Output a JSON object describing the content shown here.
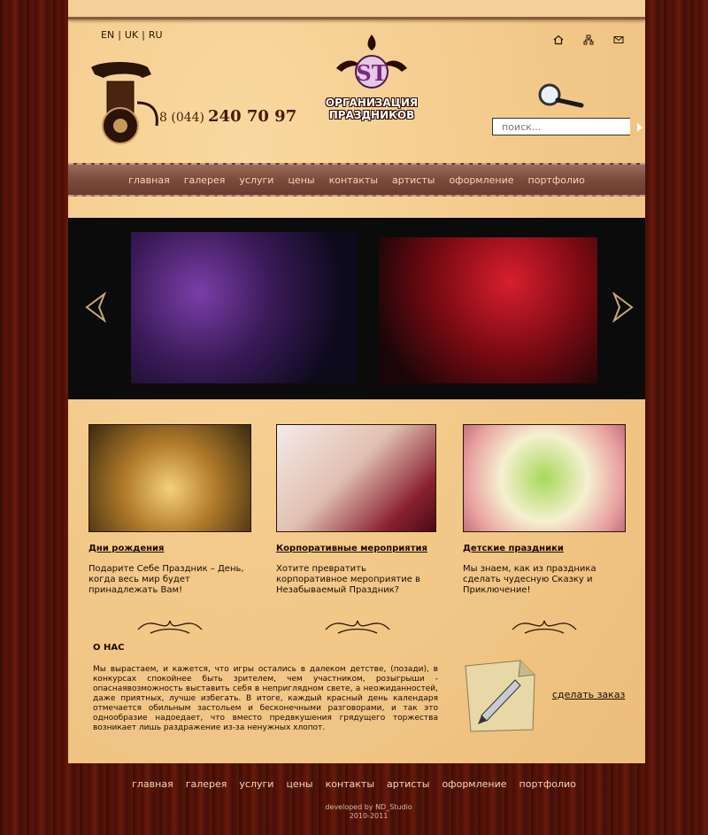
{
  "languages": [
    "EN",
    "UK",
    "RU"
  ],
  "top_icons": [
    "home-icon",
    "sitemap-icon",
    "mail-icon"
  ],
  "phone": {
    "prefix": "8 (044)",
    "number": "240 70 97"
  },
  "logo": {
    "monogram": "ST",
    "line1": "ОРГАНИЗАЦИЯ",
    "line2": "ПРАЗДНИКОВ"
  },
  "search": {
    "placeholder": "поиск..."
  },
  "nav": [
    "главная",
    "галерея",
    "услуги",
    "цены",
    "контакты",
    "артисты",
    "оформление",
    "портфолио"
  ],
  "slider": {
    "prev_icon": "chevron-left-icon",
    "next_icon": "chevron-right-icon"
  },
  "cards": [
    {
      "title": "Дни рождения",
      "text": "Подарите Себе Праздник – День, когда весь мир будет принадлежать Вам!"
    },
    {
      "title": "Корпоративные мероприятия",
      "text": "Хотите превратить корпоративное мероприятие в Незабываемый Праздник?"
    },
    {
      "title": "Детские праздники",
      "text": "Мы знаем, как из праздника сделать чудесную Сказку и Приключение!"
    }
  ],
  "about": {
    "title": "О НАС",
    "text": "Мы вырастаем, и кажется, что игры остались в далеком детстве, (позади), в конкурсах спокойнее быть зрителем, чем участником, розыгрыши - опаснаявозможность выставить себя в неприглядном свете, а неожиданностей, даже приятных, лучше избегать. В итоге, каждый красный день календаря отмечается обильным застольем и бесконечными разговорами, и так это однообразие надоедает, что вместо предвкушения грядущего торжества возникает лишь раздражение из-за ненужных хлопот."
  },
  "order": {
    "label": "сделать заказ"
  },
  "footer": {
    "nav": [
      "главная",
      "галерея",
      "услуги",
      "цены",
      "контакты",
      "артисты",
      "оформление",
      "портфолио"
    ],
    "credit": "developed by ND_Studio",
    "years": "2010-2011"
  }
}
